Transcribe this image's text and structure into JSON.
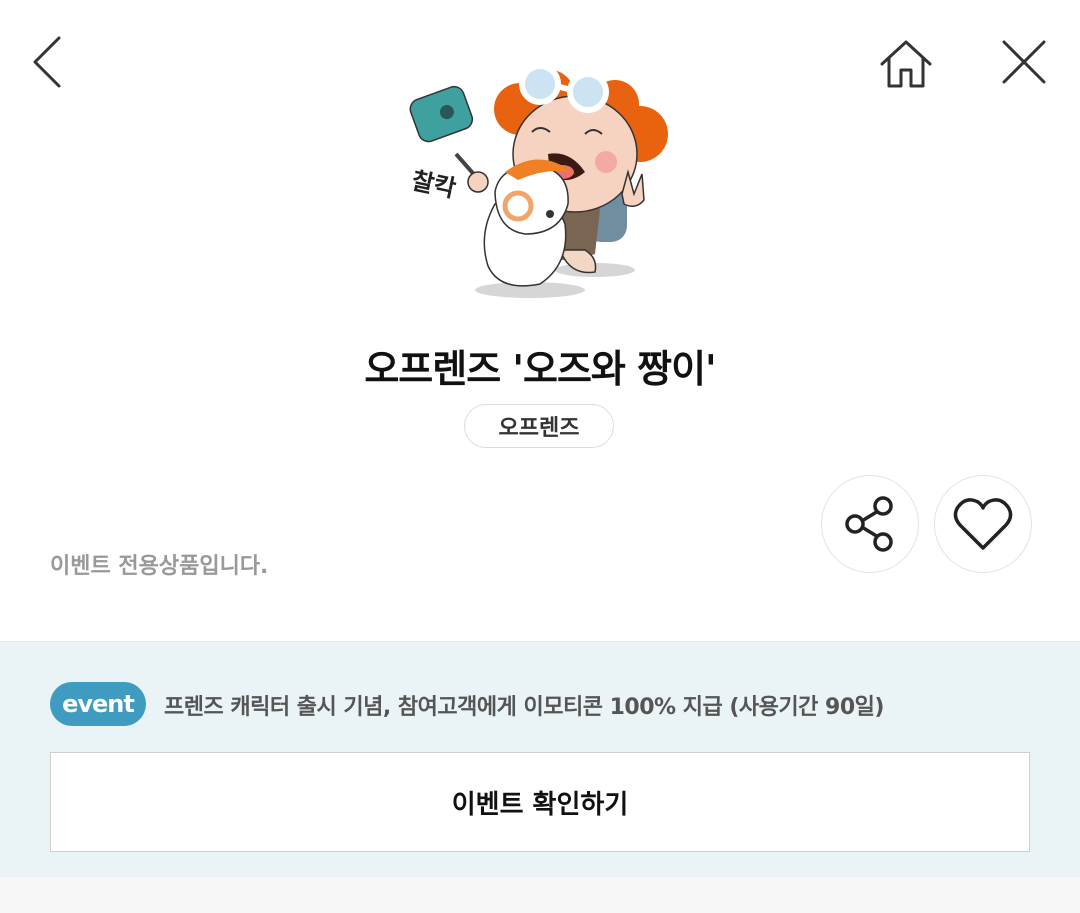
{
  "nav": {
    "back_icon": "chevron-left-icon",
    "home_icon": "home-icon",
    "close_icon": "close-icon"
  },
  "product": {
    "sticker_text": "찰칵",
    "title": "오프렌즈 '오즈와 짱이'",
    "brand": "오프렌즈",
    "exclusive_note": "이벤트 전용상품입니다.",
    "share_icon": "share-icon",
    "like_icon": "heart-icon"
  },
  "event": {
    "badge": "event",
    "description": "프렌즈 캐릭터 출시 기념, 참여고객에게 이모티콘 100% 지급 (사용기간 90일)",
    "button_label": "이벤트 확인하기"
  },
  "colors": {
    "accent": "#3f9cc0",
    "event_bg": "#eaf4f7",
    "note_gray": "#999999"
  }
}
